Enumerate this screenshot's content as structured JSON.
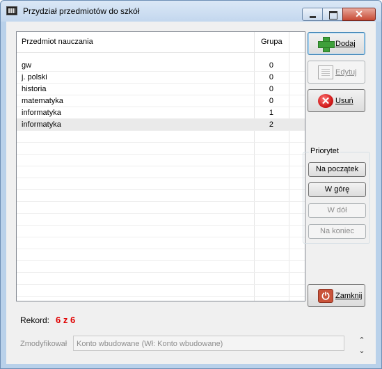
{
  "window": {
    "title": "Przydział przedmiotów do szkół"
  },
  "list": {
    "columns": [
      "Przedmiot nauczania",
      "Grupa"
    ],
    "rows": [
      {
        "subject": "gw",
        "group": "0"
      },
      {
        "subject": "j. polski",
        "group": "0"
      },
      {
        "subject": "historia",
        "group": "0"
      },
      {
        "subject": "matematyka",
        "group": "0"
      },
      {
        "subject": "informatyka",
        "group": "1"
      },
      {
        "subject": "informatyka",
        "group": "2"
      }
    ]
  },
  "actions": {
    "add": "Dodaj",
    "edit": "Edytuj",
    "delete": "Usuń",
    "close": "Zamknij"
  },
  "priority": {
    "title": "Priorytet",
    "to_start": "Na początek",
    "up": "W górę",
    "down": "W dół",
    "to_end": "Na koniec"
  },
  "record": {
    "label": "Rekord:",
    "value": "6 z 6"
  },
  "modified": {
    "label": "Zmodyfikował",
    "value": "Konto wbudowane (Wł: Konto wbudowane)"
  },
  "icons": {
    "add": "plus-icon",
    "edit": "edit-icon",
    "delete": "delete-icon",
    "close": "power-icon",
    "window_min": "minimize-icon",
    "window_max": "maximize-icon",
    "window_close": "close-icon"
  },
  "colors": {
    "record_value": "#e00000",
    "titlebar": "#c3d7ee",
    "close_button": "#c74a35"
  }
}
